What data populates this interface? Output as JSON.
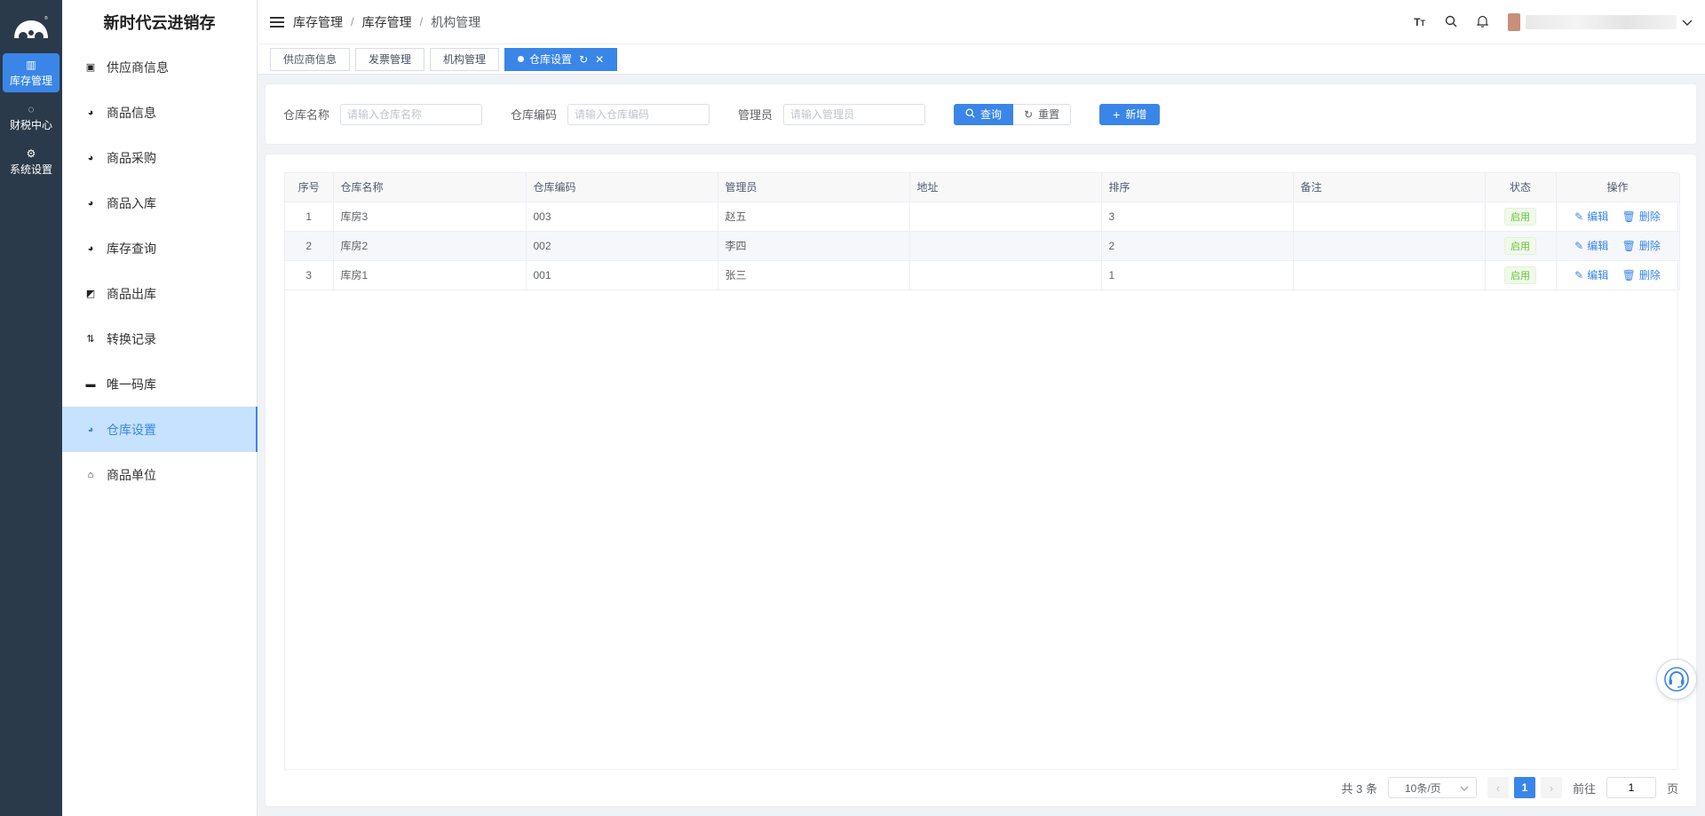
{
  "rail": {
    "items": [
      {
        "label": "库存管理",
        "icon": "grid-icon",
        "active": true
      },
      {
        "label": "财税中心",
        "icon": "apple-icon",
        "active": false
      },
      {
        "label": "系统设置",
        "icon": "gear-icon",
        "active": false
      }
    ]
  },
  "side": {
    "title": "新时代云进销存",
    "items": [
      {
        "label": "供应商信息",
        "icon": "id-card-icon"
      },
      {
        "label": "商品信息",
        "icon": "dashboard-icon"
      },
      {
        "label": "商品采购",
        "icon": "dashboard-icon"
      },
      {
        "label": "商品入库",
        "icon": "dashboard-icon"
      },
      {
        "label": "库存查询",
        "icon": "dashboard-icon"
      },
      {
        "label": "商品出库",
        "icon": "k-square-icon"
      },
      {
        "label": "转换记录",
        "icon": "switch-arrows-icon"
      },
      {
        "label": "唯一码库",
        "icon": "monitor-icon"
      },
      {
        "label": "仓库设置",
        "icon": "dashboard-icon"
      },
      {
        "label": "商品单位",
        "icon": "bell-dome-icon"
      }
    ],
    "active_index": 8
  },
  "header": {
    "breadcrumb": [
      "库存管理",
      "库存管理",
      "机构管理"
    ],
    "separator": "/",
    "icons": [
      "font-size-icon",
      "search-icon",
      "bell-icon"
    ]
  },
  "tags": [
    {
      "label": "供应商信息",
      "active": false
    },
    {
      "label": "发票管理",
      "active": false
    },
    {
      "label": "机构管理",
      "active": false
    },
    {
      "label": "仓库设置",
      "active": true
    }
  ],
  "search": {
    "fields": [
      {
        "label": "仓库名称",
        "placeholder": "请输入仓库名称",
        "value": ""
      },
      {
        "label": "仓库编码",
        "placeholder": "请输入仓库编码",
        "value": ""
      },
      {
        "label": "管理员",
        "placeholder": "请输入管理员",
        "value": ""
      }
    ],
    "query_label": "查询",
    "reset_label": "重置",
    "add_label": "新增"
  },
  "table": {
    "columns": [
      "序号",
      "仓库名称",
      "仓库编码",
      "管理员",
      "地址",
      "排序",
      "备注",
      "状态",
      "操作"
    ],
    "rows": [
      {
        "index": "1",
        "name": "库房3",
        "code": "003",
        "manager": "赵五",
        "address": "",
        "sort": "3",
        "remark": "",
        "status": "启用"
      },
      {
        "index": "2",
        "name": "库房2",
        "code": "002",
        "manager": "李四",
        "address": "",
        "sort": "2",
        "remark": "",
        "status": "启用"
      },
      {
        "index": "3",
        "name": "库房1",
        "code": "001",
        "manager": "张三",
        "address": "",
        "sort": "1",
        "remark": "",
        "status": "启用"
      }
    ],
    "edit_label": "编辑",
    "delete_label": "删除"
  },
  "pager": {
    "total_text": "共 3 条",
    "page_size": "10条/页",
    "current_page": "1",
    "goto_label": "前往",
    "goto_value": "1",
    "page_suffix": "页"
  },
  "colors": {
    "primary": "#3a86e8",
    "rail_bg": "#2b3a4a",
    "active_menu_bg": "#c6e2ff",
    "status_green": "#67c23a"
  }
}
